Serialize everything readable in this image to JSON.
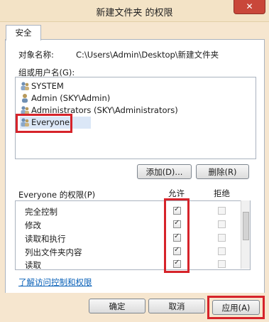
{
  "window": {
    "title": "新建文件夹 的权限",
    "close_glyph": "✕"
  },
  "tabs": [
    {
      "label": "安全"
    }
  ],
  "object": {
    "label": "对象名称:",
    "value": "C:\\Users\\Admin\\Desktop\\新建文件夹"
  },
  "groups": {
    "label": "组或用户名(G):",
    "items": [
      {
        "name": "SYSTEM",
        "icon": "group-icon",
        "selected": false
      },
      {
        "name": "Admin (SKY\\Admin)",
        "icon": "user-icon",
        "selected": false
      },
      {
        "name": "Administrators (SKY\\Administrators)",
        "icon": "group-icon",
        "selected": false
      },
      {
        "name": "Everyone",
        "icon": "group-icon",
        "selected": true
      }
    ]
  },
  "buttons": {
    "add": "添加(D)...",
    "remove": "删除(R)",
    "ok": "确定",
    "cancel": "取消",
    "apply": "应用(A)"
  },
  "permissions": {
    "label": "Everyone 的权限(P)",
    "allow_header": "允许",
    "deny_header": "拒绝",
    "rows": [
      {
        "name": "完全控制",
        "allow": true,
        "deny": false
      },
      {
        "name": "修改",
        "allow": true,
        "deny": false
      },
      {
        "name": "读取和执行",
        "allow": true,
        "deny": false
      },
      {
        "name": "列出文件夹内容",
        "allow": true,
        "deny": false
      },
      {
        "name": "读取",
        "allow": true,
        "deny": false
      }
    ]
  },
  "links": {
    "advanced": "了解访问控制和权限"
  },
  "colors": {
    "highlight": "#d6232a",
    "close": "#c9473a",
    "link": "#0a61b8"
  }
}
